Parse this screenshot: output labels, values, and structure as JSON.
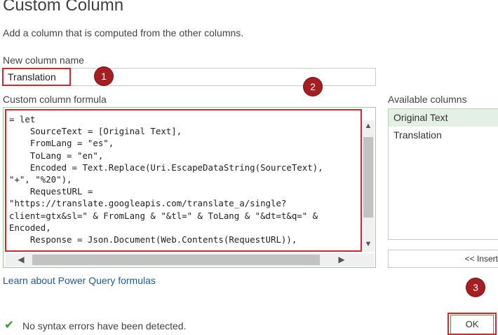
{
  "dialog": {
    "title": "Custom Column",
    "subtitle": "Add a column that is computed from the other columns."
  },
  "new_column": {
    "label": "New column name",
    "value": "Translation"
  },
  "formula": {
    "label": "Custom column formula",
    "text": "= let\n    SourceText = [Original Text],\n    FromLang = \"es\",\n    ToLang = \"en\",\n    Encoded = Text.Replace(Uri.EscapeDataString(SourceText),\n\"+\", \"%20\"),\n    RequestURL =\n\"https://translate.googleapis.com/translate_a/single?\nclient=gtx&sl=\" & FromLang & \"&tl=\" & ToLang & \"&dt=t&q=\" &\nEncoded,\n    Response = Json.Document(Web.Contents(RequestURL)),"
  },
  "available_columns": {
    "label": "Available columns",
    "items": [
      {
        "label": "Original Text",
        "selected": true
      },
      {
        "label": "Translation",
        "selected": false
      }
    ],
    "insert_label": "<< Insert"
  },
  "help_link": "Learn about Power Query formulas",
  "status": {
    "text": "No syntax errors have been detected.",
    "icon": "checkmark-icon",
    "color": "#3a9b3a"
  },
  "ok_label": "OK",
  "annotations": {
    "badge1": "1",
    "badge2": "2",
    "badge3": "3"
  },
  "colors": {
    "highlight": "#d9252b",
    "badge": "#a41e22",
    "link": "#1e5a96",
    "selected_row": "#e3f1e3"
  }
}
